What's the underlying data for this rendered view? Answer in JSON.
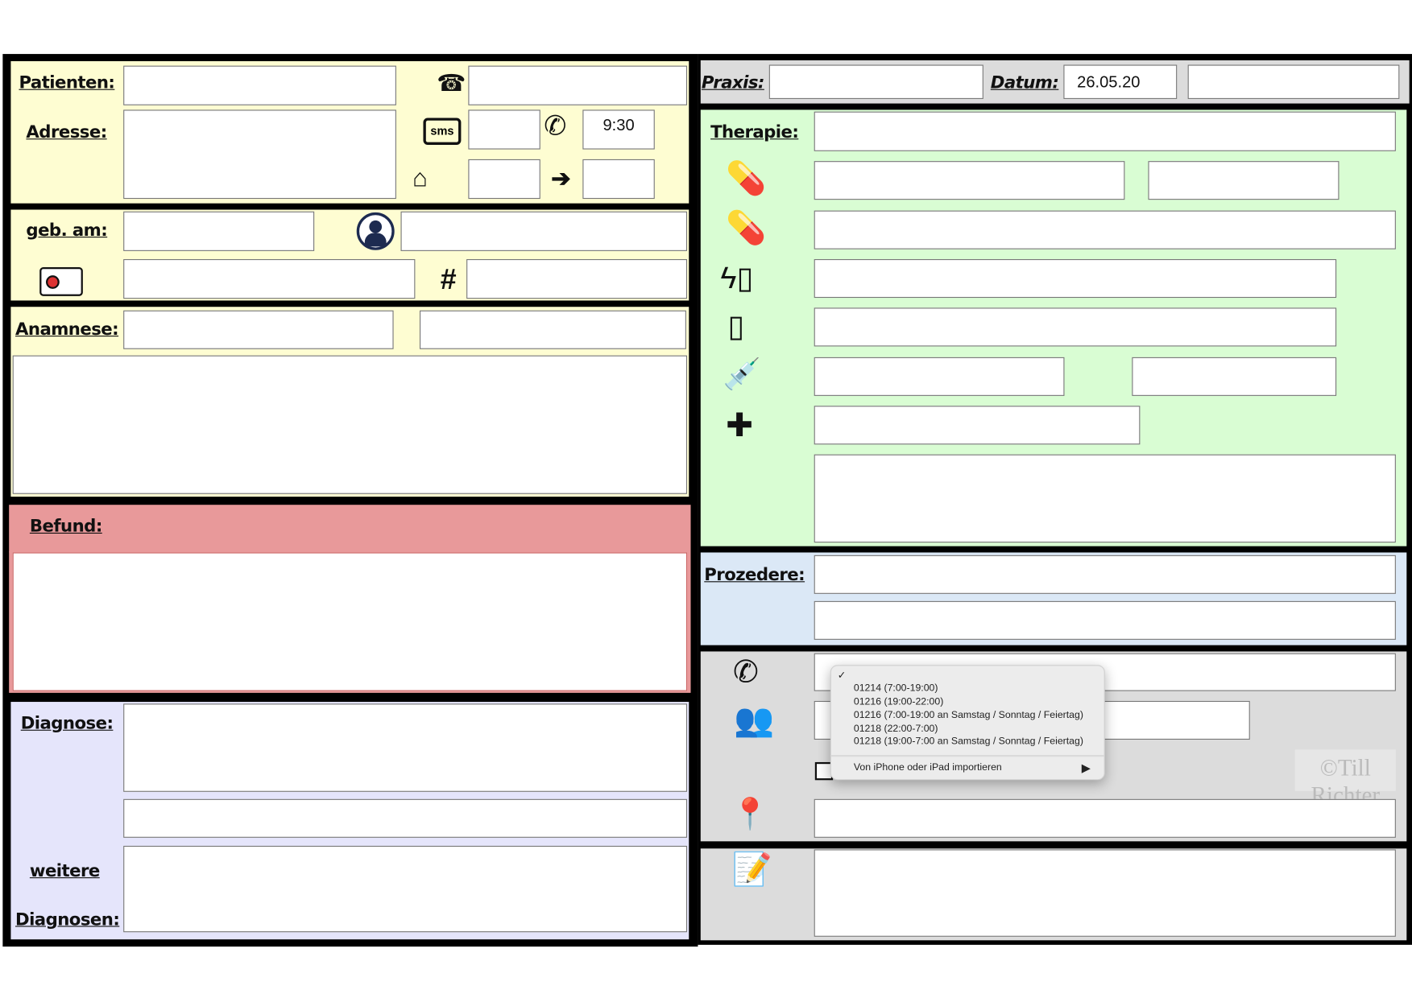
{
  "patient": {
    "name_label": "Patienten:",
    "address_label": "Adresse:",
    "phone_icon": "telephone-icon",
    "sms_label": "sms",
    "callback_time": "9:30",
    "dob_label": "geb. am:",
    "hash_label": "#",
    "anamnesis_label": "Anamnese:"
  },
  "befund": {
    "label": "Befund:",
    "color": "#e8999a"
  },
  "diagnose": {
    "label": "Diagnose:",
    "further_label_1": "weitere",
    "further_label_2": "Diagnosen:"
  },
  "header": {
    "praxis_label": "Praxis:",
    "datum_label": "Datum:",
    "datum_value": "26.05.20"
  },
  "therapie": {
    "label": "Therapie:"
  },
  "prozedere": {
    "label": "Prozedere:"
  },
  "dropdown": {
    "checkmark": "✓",
    "options": [
      "01214 (7:00-19:00)",
      "01216 (19:00-22:00)",
      "01216 (7:00-19:00 an Samstag / Sonntag / Feiertag)",
      "01218 (22:00-7:00)",
      "01218 (19:00-7:00 an Samstag / Sonntag / Feiertag)"
    ],
    "import_label": "Von iPhone oder iPad importieren",
    "submenu_arrow": "▶"
  },
  "watermark": "©Till Richter",
  "colors": {
    "yellow": "#fefdd2",
    "green": "#d9fdd3",
    "blue": "#dbe8f6",
    "lavender": "#e5e5fb",
    "gray": "#dcdcdc"
  }
}
